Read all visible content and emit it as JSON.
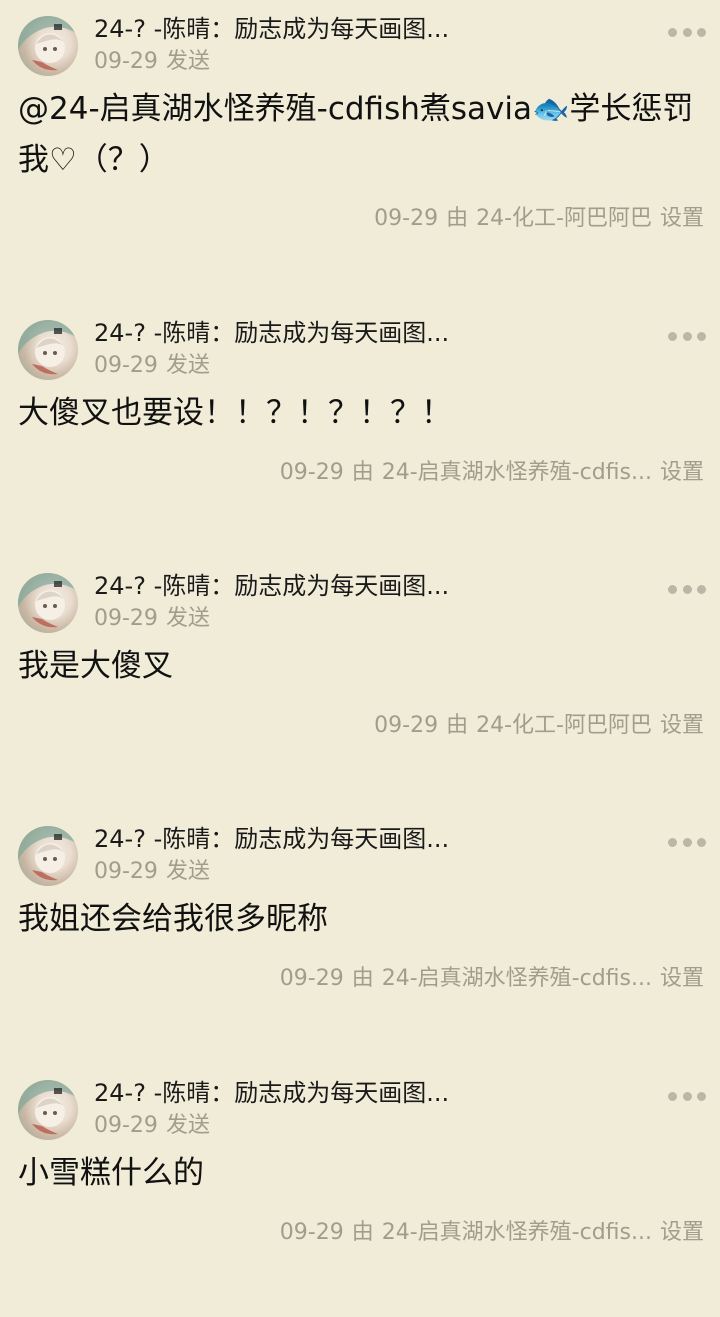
{
  "posts": [
    {
      "author": "24-?  -陈晴：励志成为每天画图...",
      "date": "09-29",
      "sent_label": "发送",
      "content_parts": [
        "@24-启真湖水怪养殖-cdfish煮savia",
        "🐟",
        "学长惩罚我♡（？）"
      ],
      "footer_date": "09-29",
      "footer_by": "由",
      "footer_source": "24-化工-阿巴阿巴",
      "footer_settings": "设置"
    },
    {
      "author": "24-?  -陈晴：励志成为每天画图...",
      "date": "09-29",
      "sent_label": "发送",
      "content_parts": [
        "大傻叉也要设！！？！？！？！"
      ],
      "footer_date": "09-29",
      "footer_by": "由",
      "footer_source": "24-启真湖水怪养殖-cdfis...",
      "footer_settings": "设置"
    },
    {
      "author": "24-?  -陈晴：励志成为每天画图...",
      "date": "09-29",
      "sent_label": "发送",
      "content_parts": [
        "我是大傻叉"
      ],
      "footer_date": "09-29",
      "footer_by": "由",
      "footer_source": "24-化工-阿巴阿巴",
      "footer_settings": "设置"
    },
    {
      "author": "24-?  -陈晴：励志成为每天画图...",
      "date": "09-29",
      "sent_label": "发送",
      "content_parts": [
        "我姐还会给我很多昵称"
      ],
      "footer_date": "09-29",
      "footer_by": "由",
      "footer_source": "24-启真湖水怪养殖-cdfis...",
      "footer_settings": "设置"
    },
    {
      "author": "24-?  -陈晴：励志成为每天画图...",
      "date": "09-29",
      "sent_label": "发送",
      "content_parts": [
        "小雪糕什么的"
      ],
      "footer_date": "09-29",
      "footer_by": "由",
      "footer_source": "24-启真湖水怪养殖-cdfis...",
      "footer_settings": "设置"
    }
  ],
  "icons": {
    "more": "more-dots-icon",
    "avatar": "user-avatar"
  },
  "colors": {
    "background": "#f0ecd8",
    "meta_text": "#a39c8c",
    "dots": "#bdb6a6"
  }
}
